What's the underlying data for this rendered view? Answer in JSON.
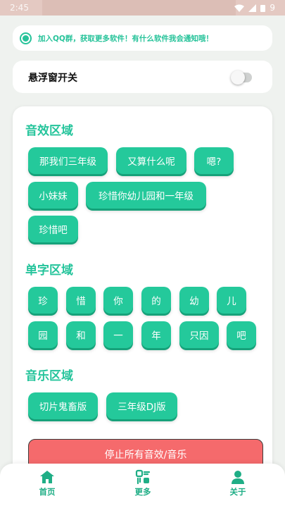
{
  "status_bar": {
    "time": "2:45",
    "battery_text": "9",
    "icons": [
      "wifi-icon",
      "signal-icon",
      "battery-icon"
    ]
  },
  "notice": {
    "text": "加入QQ群，获取更多软件！有什么软件我会通知哦！"
  },
  "floating_window": {
    "label": "悬浮窗开关",
    "enabled": false
  },
  "sections": [
    {
      "title": "音效区域",
      "items": [
        "那我们三年级",
        "又算什么呢",
        "嗯?",
        "小妹妹",
        "珍惜你幼儿园和一年级",
        "珍惜吧"
      ]
    },
    {
      "title": "单字区域",
      "items": [
        "珍",
        "惜",
        "你",
        "的",
        "幼",
        "儿",
        "园",
        "和",
        "一",
        "年",
        "只因",
        "吧"
      ]
    },
    {
      "title": "音乐区域",
      "items": [
        "切片鬼畜版",
        "三年级DJ版"
      ]
    }
  ],
  "stop_button": {
    "label": "停止所有音效/音乐"
  },
  "bottom_nav": [
    {
      "label": "首页",
      "icon": "home-icon"
    },
    {
      "label": "更多",
      "icon": "more-icon"
    },
    {
      "label": "关于",
      "icon": "user-icon"
    }
  ],
  "colors": {
    "accent": "#24c99b",
    "stop": "#f56a6c",
    "background": "#eff2ef"
  }
}
